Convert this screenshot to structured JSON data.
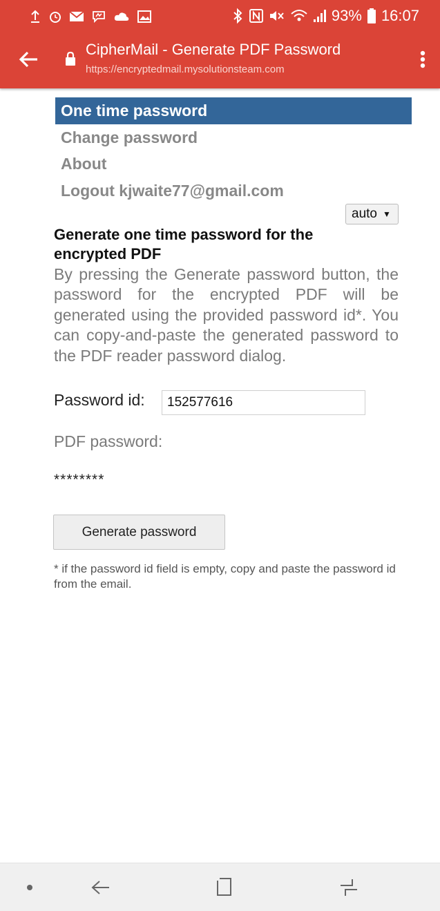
{
  "status_bar": {
    "icons_left": [
      "upload-icon",
      "alarm-icon",
      "mail-icon",
      "messenger-icon",
      "cloud-icon",
      "image-icon"
    ],
    "icons_right": [
      "bluetooth-icon",
      "nfc-icon",
      "mute-icon",
      "wifi-icon",
      "signal-icon",
      "battery-icon"
    ],
    "battery": "93%",
    "time": "16:07"
  },
  "browser": {
    "title": "CipherMail - Generate PDF Password",
    "url": "https://encryptedmail.mysolutionsteam.com",
    "accent_color": "#db4437"
  },
  "nav": {
    "items": [
      {
        "label": "One time password",
        "active": true
      },
      {
        "label": "Change password",
        "active": false
      },
      {
        "label": "About",
        "active": false
      },
      {
        "label": "Logout kjwaite77@gmail.com",
        "active": false
      }
    ],
    "active_color": "#336699"
  },
  "language": {
    "selected": "auto"
  },
  "content": {
    "heading": "Generate one time password for the encrypted PDF",
    "description": "By pressing the Generate password button, the password for the encrypted PDF will be generated using the provided password id*. You can copy-and-paste the generated password to the PDF reader password dialog.",
    "password_id_label": "Password id:",
    "password_id_value": "152577616",
    "pdf_password_label": "PDF password:",
    "pdf_password_value": "********",
    "generate_button": "Generate password",
    "footnote": "* if the password id field is empty, copy and paste the password id from the email."
  },
  "system_nav": [
    "dot-icon",
    "back-icon",
    "home-icon",
    "recents-icon"
  ]
}
